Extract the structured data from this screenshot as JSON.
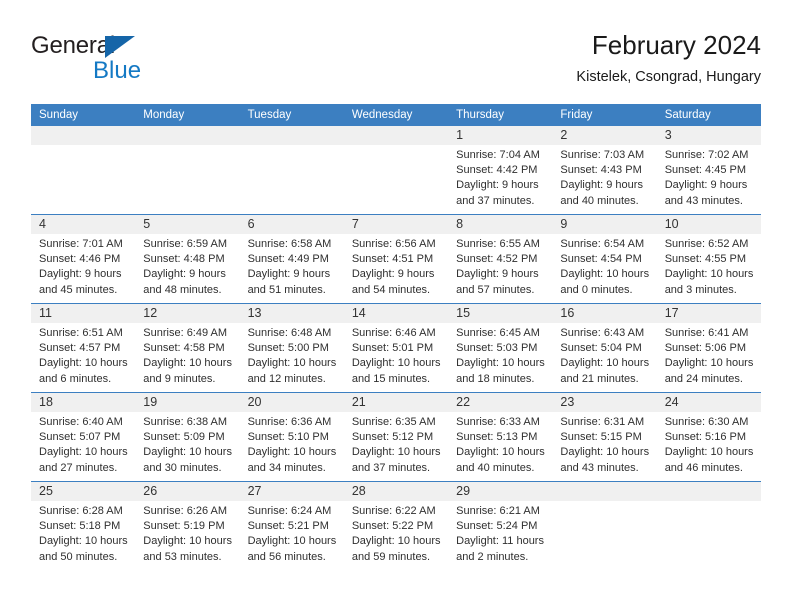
{
  "brand": {
    "name_dark": "General",
    "name_blue": "Blue",
    "flag_icon": "triangle-flag-icon",
    "accent_color": "#1479c4",
    "flag_color": "#1565a8"
  },
  "header": {
    "title": "February 2024",
    "subtitle": "Kistelek, Csongrad, Hungary"
  },
  "calendar": {
    "header_bg": "#3c7fc1",
    "day_band_bg": "#f0f0f0",
    "weekdays": [
      "Sunday",
      "Monday",
      "Tuesday",
      "Wednesday",
      "Thursday",
      "Friday",
      "Saturday"
    ],
    "weeks": [
      [
        {
          "day": "",
          "lines": []
        },
        {
          "day": "",
          "lines": []
        },
        {
          "day": "",
          "lines": []
        },
        {
          "day": "",
          "lines": []
        },
        {
          "day": "1",
          "lines": [
            "Sunrise: 7:04 AM",
            "Sunset: 4:42 PM",
            "Daylight: 9 hours",
            "and 37 minutes."
          ]
        },
        {
          "day": "2",
          "lines": [
            "Sunrise: 7:03 AM",
            "Sunset: 4:43 PM",
            "Daylight: 9 hours",
            "and 40 minutes."
          ]
        },
        {
          "day": "3",
          "lines": [
            "Sunrise: 7:02 AM",
            "Sunset: 4:45 PM",
            "Daylight: 9 hours",
            "and 43 minutes."
          ]
        }
      ],
      [
        {
          "day": "4",
          "lines": [
            "Sunrise: 7:01 AM",
            "Sunset: 4:46 PM",
            "Daylight: 9 hours",
            "and 45 minutes."
          ]
        },
        {
          "day": "5",
          "lines": [
            "Sunrise: 6:59 AM",
            "Sunset: 4:48 PM",
            "Daylight: 9 hours",
            "and 48 minutes."
          ]
        },
        {
          "day": "6",
          "lines": [
            "Sunrise: 6:58 AM",
            "Sunset: 4:49 PM",
            "Daylight: 9 hours",
            "and 51 minutes."
          ]
        },
        {
          "day": "7",
          "lines": [
            "Sunrise: 6:56 AM",
            "Sunset: 4:51 PM",
            "Daylight: 9 hours",
            "and 54 minutes."
          ]
        },
        {
          "day": "8",
          "lines": [
            "Sunrise: 6:55 AM",
            "Sunset: 4:52 PM",
            "Daylight: 9 hours",
            "and 57 minutes."
          ]
        },
        {
          "day": "9",
          "lines": [
            "Sunrise: 6:54 AM",
            "Sunset: 4:54 PM",
            "Daylight: 10 hours",
            "and 0 minutes."
          ]
        },
        {
          "day": "10",
          "lines": [
            "Sunrise: 6:52 AM",
            "Sunset: 4:55 PM",
            "Daylight: 10 hours",
            "and 3 minutes."
          ]
        }
      ],
      [
        {
          "day": "11",
          "lines": [
            "Sunrise: 6:51 AM",
            "Sunset: 4:57 PM",
            "Daylight: 10 hours",
            "and 6 minutes."
          ]
        },
        {
          "day": "12",
          "lines": [
            "Sunrise: 6:49 AM",
            "Sunset: 4:58 PM",
            "Daylight: 10 hours",
            "and 9 minutes."
          ]
        },
        {
          "day": "13",
          "lines": [
            "Sunrise: 6:48 AM",
            "Sunset: 5:00 PM",
            "Daylight: 10 hours",
            "and 12 minutes."
          ]
        },
        {
          "day": "14",
          "lines": [
            "Sunrise: 6:46 AM",
            "Sunset: 5:01 PM",
            "Daylight: 10 hours",
            "and 15 minutes."
          ]
        },
        {
          "day": "15",
          "lines": [
            "Sunrise: 6:45 AM",
            "Sunset: 5:03 PM",
            "Daylight: 10 hours",
            "and 18 minutes."
          ]
        },
        {
          "day": "16",
          "lines": [
            "Sunrise: 6:43 AM",
            "Sunset: 5:04 PM",
            "Daylight: 10 hours",
            "and 21 minutes."
          ]
        },
        {
          "day": "17",
          "lines": [
            "Sunrise: 6:41 AM",
            "Sunset: 5:06 PM",
            "Daylight: 10 hours",
            "and 24 minutes."
          ]
        }
      ],
      [
        {
          "day": "18",
          "lines": [
            "Sunrise: 6:40 AM",
            "Sunset: 5:07 PM",
            "Daylight: 10 hours",
            "and 27 minutes."
          ]
        },
        {
          "day": "19",
          "lines": [
            "Sunrise: 6:38 AM",
            "Sunset: 5:09 PM",
            "Daylight: 10 hours",
            "and 30 minutes."
          ]
        },
        {
          "day": "20",
          "lines": [
            "Sunrise: 6:36 AM",
            "Sunset: 5:10 PM",
            "Daylight: 10 hours",
            "and 34 minutes."
          ]
        },
        {
          "day": "21",
          "lines": [
            "Sunrise: 6:35 AM",
            "Sunset: 5:12 PM",
            "Daylight: 10 hours",
            "and 37 minutes."
          ]
        },
        {
          "day": "22",
          "lines": [
            "Sunrise: 6:33 AM",
            "Sunset: 5:13 PM",
            "Daylight: 10 hours",
            "and 40 minutes."
          ]
        },
        {
          "day": "23",
          "lines": [
            "Sunrise: 6:31 AM",
            "Sunset: 5:15 PM",
            "Daylight: 10 hours",
            "and 43 minutes."
          ]
        },
        {
          "day": "24",
          "lines": [
            "Sunrise: 6:30 AM",
            "Sunset: 5:16 PM",
            "Daylight: 10 hours",
            "and 46 minutes."
          ]
        }
      ],
      [
        {
          "day": "25",
          "lines": [
            "Sunrise: 6:28 AM",
            "Sunset: 5:18 PM",
            "Daylight: 10 hours",
            "and 50 minutes."
          ]
        },
        {
          "day": "26",
          "lines": [
            "Sunrise: 6:26 AM",
            "Sunset: 5:19 PM",
            "Daylight: 10 hours",
            "and 53 minutes."
          ]
        },
        {
          "day": "27",
          "lines": [
            "Sunrise: 6:24 AM",
            "Sunset: 5:21 PM",
            "Daylight: 10 hours",
            "and 56 minutes."
          ]
        },
        {
          "day": "28",
          "lines": [
            "Sunrise: 6:22 AM",
            "Sunset: 5:22 PM",
            "Daylight: 10 hours",
            "and 59 minutes."
          ]
        },
        {
          "day": "29",
          "lines": [
            "Sunrise: 6:21 AM",
            "Sunset: 5:24 PM",
            "Daylight: 11 hours",
            "and 2 minutes."
          ]
        },
        {
          "day": "",
          "lines": []
        },
        {
          "day": "",
          "lines": []
        }
      ]
    ]
  }
}
